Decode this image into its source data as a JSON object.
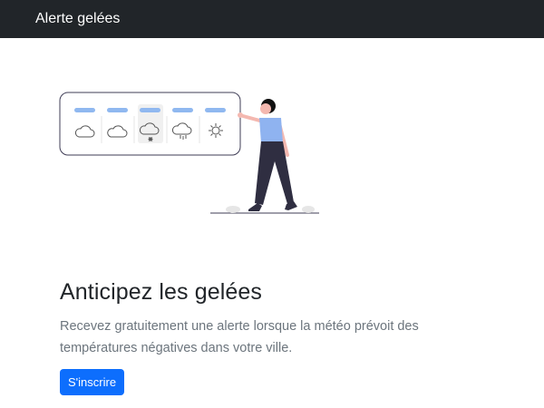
{
  "navbar": {
    "brand": "Alerte gelées"
  },
  "illustration": {
    "icons": [
      "cloud-icon",
      "cloud-icon",
      "snow-cloud-icon",
      "rain-cloud-icon",
      "sun-icon"
    ],
    "colors": {
      "accent_bar": "#90b8f0",
      "shirt": "#8fb3f0",
      "trousers": "#2f2e41",
      "skin": "#f4b8b0",
      "hair": "#111111"
    }
  },
  "hero": {
    "title": "Anticipez les gelées",
    "lead": "Recevez gratuitement une alerte lorsque la météo prévoit des températures négatives dans votre ville.",
    "cta_label": "S'inscrire"
  },
  "colors": {
    "navbar_bg": "#212529",
    "primary": "#0d6efd",
    "text": "#212529",
    "muted": "#6c757d"
  }
}
